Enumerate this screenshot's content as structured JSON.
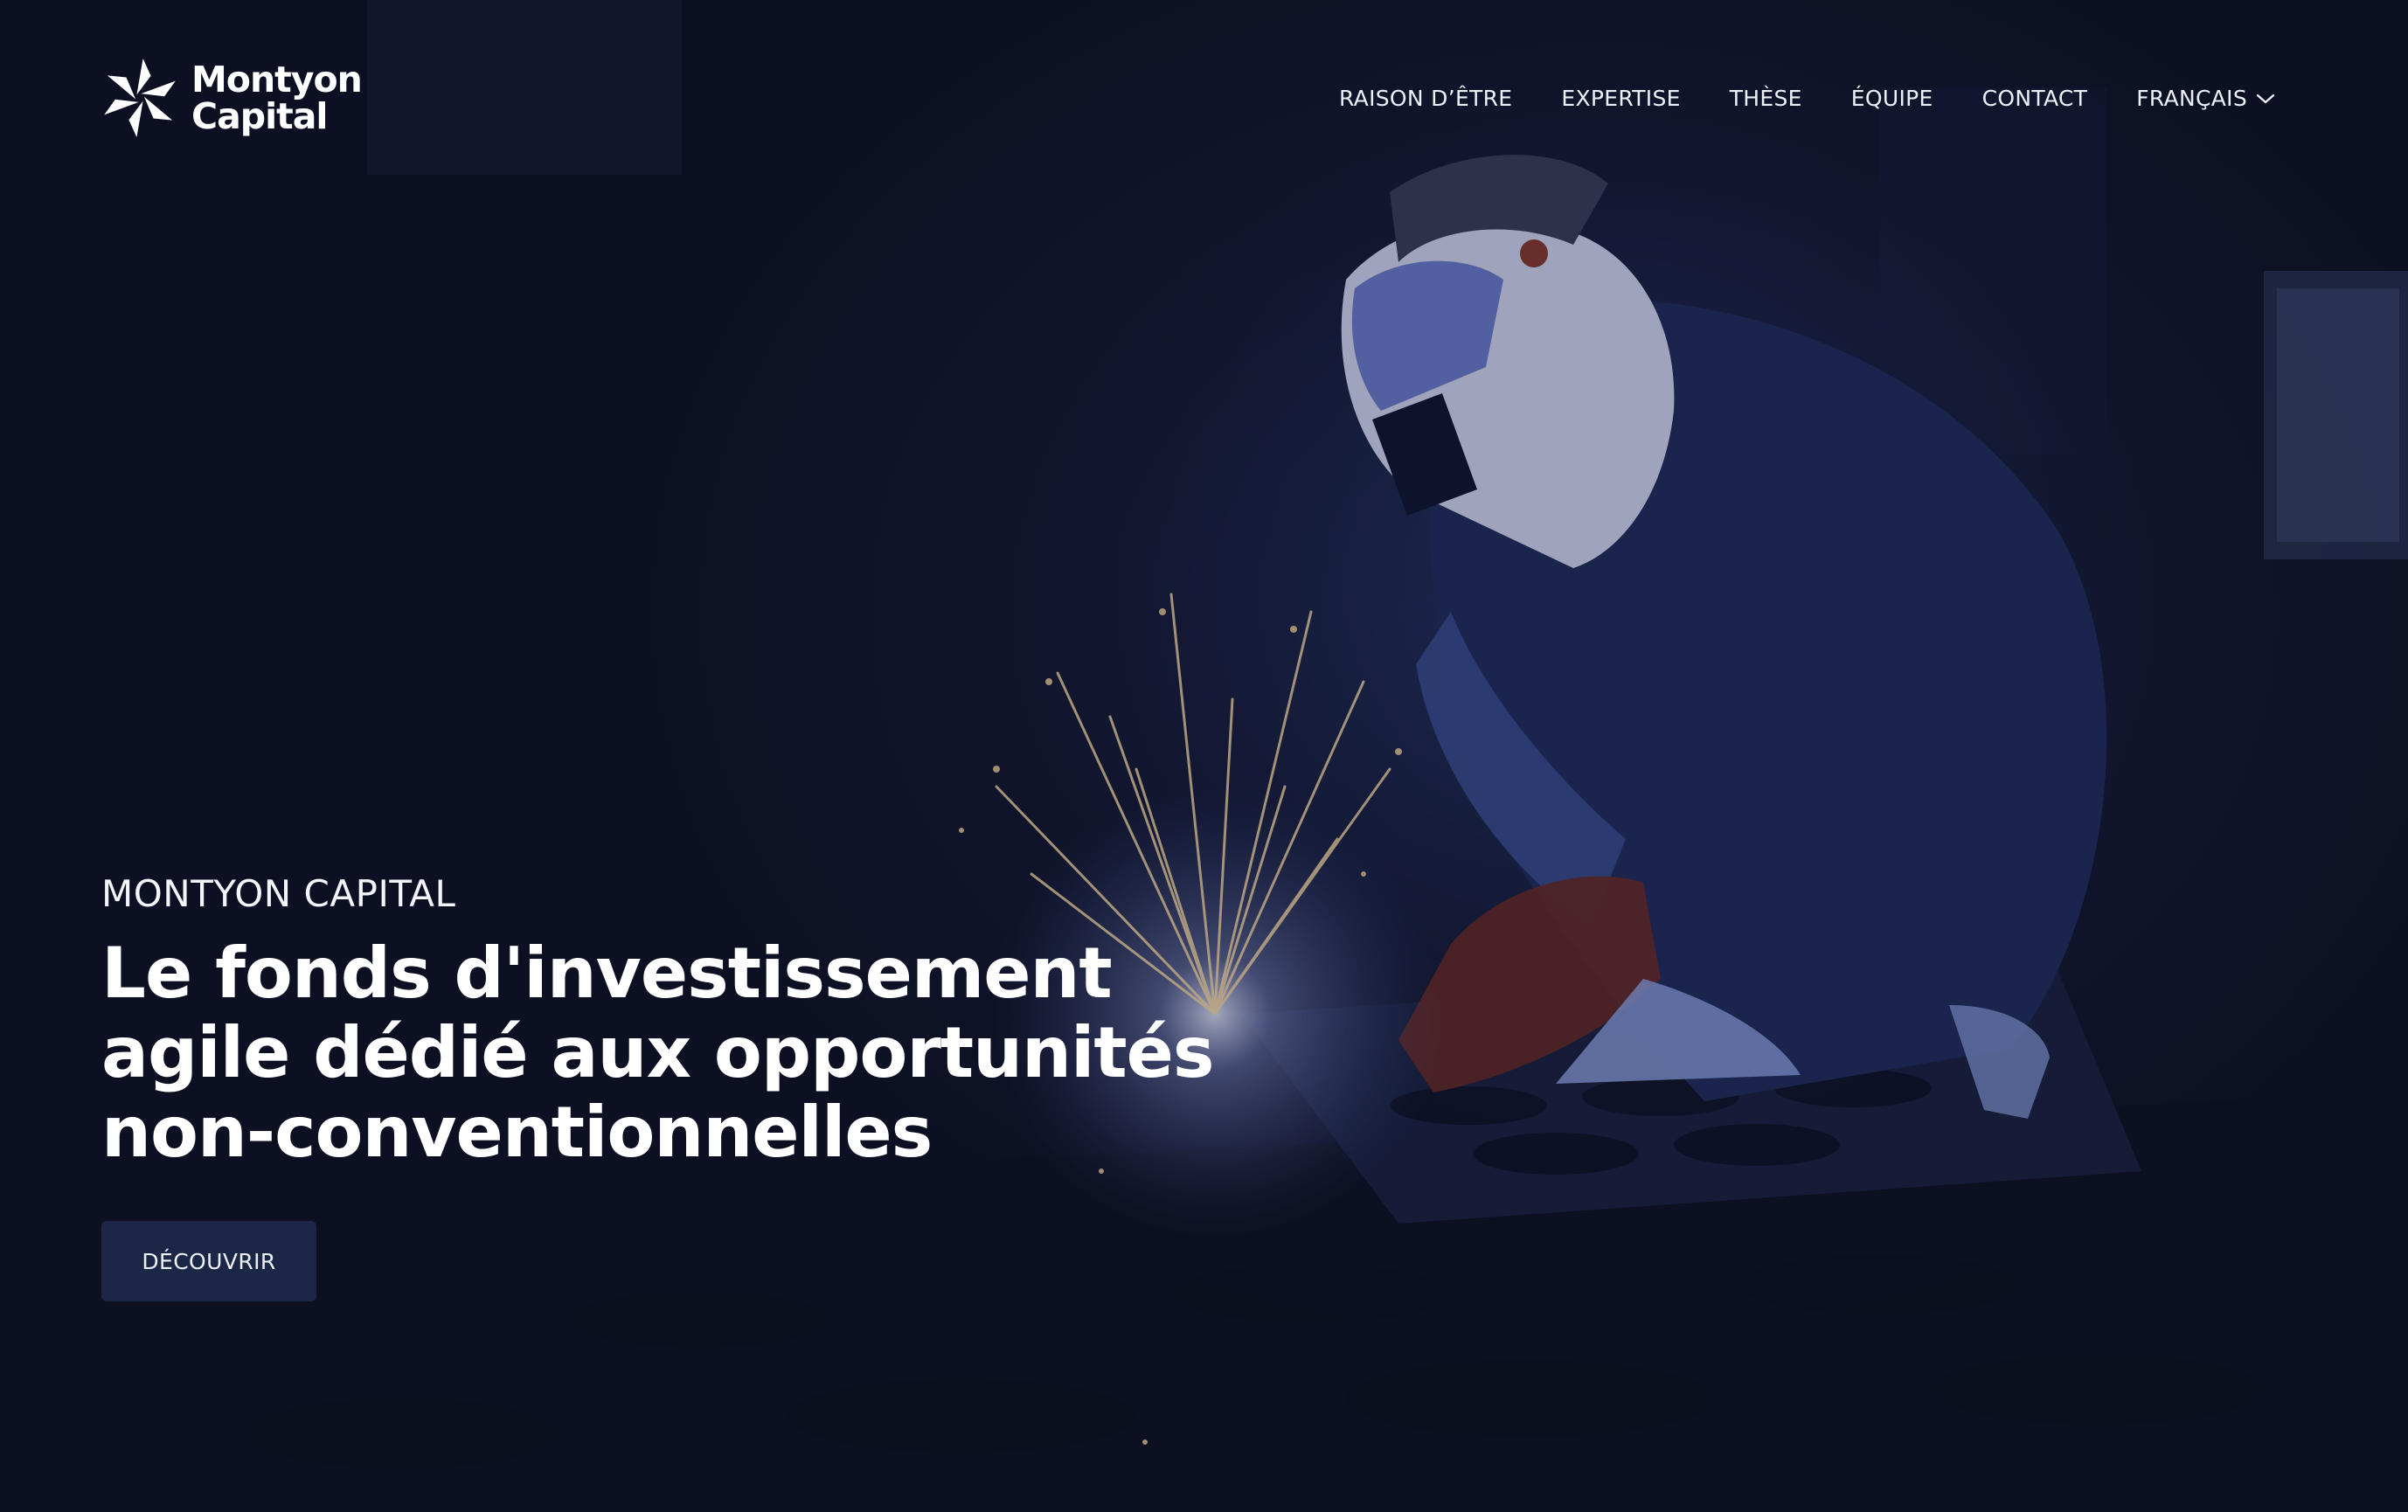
{
  "brand": {
    "line1": "Montyon",
    "line2": "Capital"
  },
  "nav": {
    "items": [
      {
        "label": "RAISON D’ÊTRE"
      },
      {
        "label": "EXPERTISE"
      },
      {
        "label": "THÈSE"
      },
      {
        "label": "ÉQUIPE"
      },
      {
        "label": "CONTACT"
      }
    ],
    "language": "FRANÇAIS"
  },
  "hero": {
    "eyebrow": "MONTYON CAPITAL",
    "headline_lines": [
      "Le fonds d'investissement",
      "agile dédié aux opportunités",
      "non-conventionnelles"
    ],
    "cta_label": "DÉCOUVRIR"
  },
  "colors": {
    "background": "#0f1326",
    "button": "#1c2748",
    "text": "#ffffff",
    "spark": "#ffd9a0"
  },
  "icons": {
    "logo": "pinwheel-logo-icon",
    "language_toggle": "chevron-down-icon"
  }
}
